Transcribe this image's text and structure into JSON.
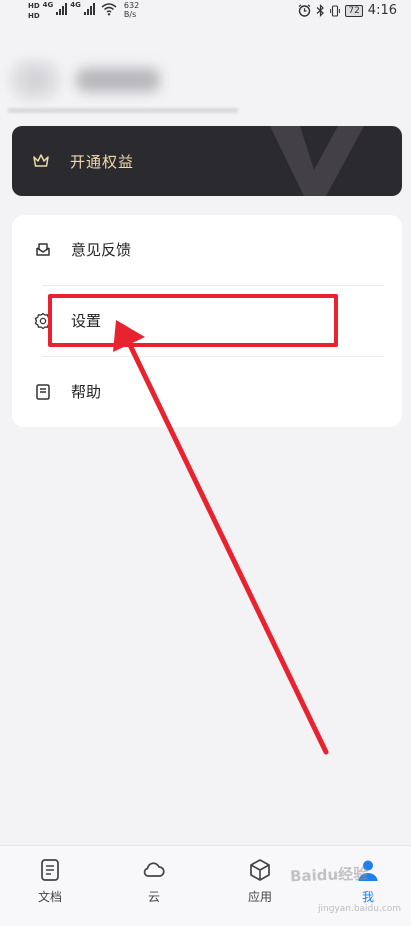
{
  "status_bar": {
    "hd1": "HD",
    "hd2": "HD",
    "net1": "4G",
    "net2": "4G",
    "speed_value": "632",
    "speed_unit": "B/s",
    "battery": "72",
    "time": "4:16"
  },
  "vip": {
    "label": "开通权益",
    "accent_color": "#efd9aa",
    "background_color": "#2b2a2e"
  },
  "menu": {
    "items": [
      {
        "label": "意见反馈",
        "icon": "feedback-icon"
      },
      {
        "label": "设置",
        "icon": "gear-icon"
      },
      {
        "label": "帮助",
        "icon": "help-doc-icon"
      }
    ]
  },
  "annotation": {
    "color": "#e8232f"
  },
  "tabs": [
    {
      "label": "文档",
      "icon": "document-icon",
      "active": false
    },
    {
      "label": "云",
      "icon": "cloud-icon",
      "active": false
    },
    {
      "label": "应用",
      "icon": "cube-icon",
      "active": false
    },
    {
      "label": "我",
      "icon": "person-icon",
      "active": true
    }
  ],
  "watermark": {
    "text": "Baidu经验",
    "sub": "jingyan.baidu.com"
  }
}
